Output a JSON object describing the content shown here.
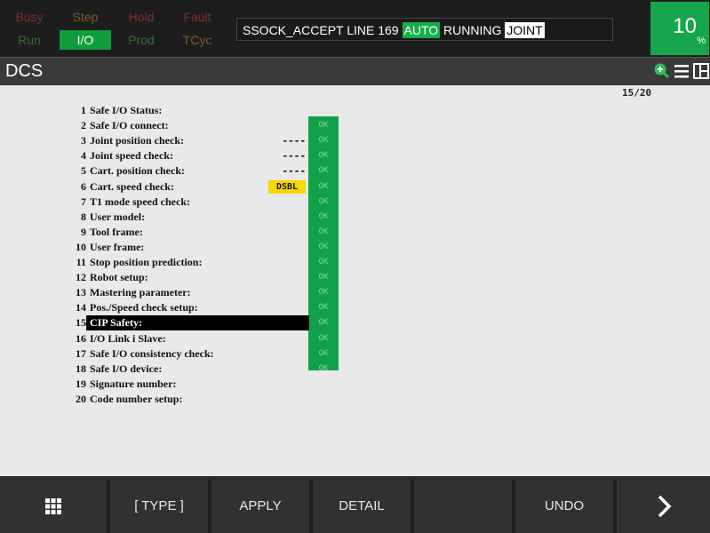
{
  "status": {
    "indicators": [
      {
        "id": "busy",
        "label": "Busy",
        "state": "off",
        "color": "#7a2e2e"
      },
      {
        "id": "step",
        "label": "Step",
        "state": "off",
        "color": "#7a5a2a"
      },
      {
        "id": "hold",
        "label": "Hold",
        "state": "off",
        "color": "#7a2e2e"
      },
      {
        "id": "fault",
        "label": "Fault",
        "state": "off",
        "color": "#7a2e2e"
      },
      {
        "id": "run",
        "label": "Run",
        "state": "off",
        "color": "#356a36"
      },
      {
        "id": "io",
        "label": "I/O",
        "state": "on",
        "color": "#0f9d3a"
      },
      {
        "id": "prod",
        "label": "Prod",
        "state": "off",
        "color": "#356a36"
      },
      {
        "id": "tcyc",
        "label": "TCyc",
        "state": "off",
        "color": "#7a5a2a"
      }
    ],
    "message": {
      "program": "SSOCK_ACCEPT LINE 169",
      "mode": "AUTO",
      "state": "RUNNING",
      "coord": "JOINT"
    },
    "override": {
      "value": "10",
      "unit": "%"
    }
  },
  "title": {
    "text": "DCS",
    "icons": [
      "zoom-in-icon",
      "menu-icon",
      "split-screen-icon"
    ]
  },
  "page_indicator": "15/20",
  "items": [
    {
      "num": "1",
      "label": "Safe I/O Status:",
      "value": "",
      "status": ""
    },
    {
      "num": "2",
      "label": "Safe I/O connect:",
      "value": "",
      "status": "OK"
    },
    {
      "num": "3",
      "label": "Joint position check:",
      "value": "----",
      "status": "OK"
    },
    {
      "num": "4",
      "label": "Joint speed check:",
      "value": "----",
      "status": "OK"
    },
    {
      "num": "5",
      "label": "Cart. position check:",
      "value": "----",
      "status": "OK"
    },
    {
      "num": "6",
      "label": "Cart. speed check:",
      "value": "DSBL",
      "status": "OK"
    },
    {
      "num": "7",
      "label": "T1 mode speed check:",
      "value": "",
      "status": "OK"
    },
    {
      "num": "8",
      "label": "User model:",
      "value": "",
      "status": "OK"
    },
    {
      "num": "9",
      "label": "Tool frame:",
      "value": "",
      "status": "OK"
    },
    {
      "num": "10",
      "label": "User frame:",
      "value": "",
      "status": "OK"
    },
    {
      "num": "11",
      "label": "Stop position prediction:",
      "value": "",
      "status": "OK"
    },
    {
      "num": "12",
      "label": "Robot setup:",
      "value": "",
      "status": "OK"
    },
    {
      "num": "13",
      "label": "Mastering parameter:",
      "value": "",
      "status": "OK"
    },
    {
      "num": "14",
      "label": "Pos./Speed check setup:",
      "value": "",
      "status": "OK"
    },
    {
      "num": "15",
      "label": "CIP Safety:",
      "value": "",
      "status": "OK",
      "selected": true
    },
    {
      "num": "16",
      "label": "I/O Link i Slave:",
      "value": "",
      "status": "OK"
    },
    {
      "num": "17",
      "label": "Safe I/O consistency check:",
      "value": "",
      "status": "OK"
    },
    {
      "num": "18",
      "label": "Safe I/O device:",
      "value": "",
      "status": "OK"
    },
    {
      "num": "19",
      "label": "Signature number:",
      "value": "",
      "status": ""
    },
    {
      "num": "20",
      "label": "Code number setup:",
      "value": "",
      "status": ""
    }
  ],
  "function_keys": [
    {
      "id": "menu",
      "label": "",
      "icon": "grid-icon"
    },
    {
      "id": "type",
      "label": "[ TYPE ]"
    },
    {
      "id": "apply",
      "label": "APPLY"
    },
    {
      "id": "detail",
      "label": "DETAIL"
    },
    {
      "id": "blank",
      "label": ""
    },
    {
      "id": "undo",
      "label": "UNDO"
    },
    {
      "id": "next",
      "label": "",
      "icon": "chevron-right-icon"
    }
  ],
  "colors": {
    "ok_green": "#11a14a",
    "dsbl_yellow": "#f7d700",
    "auto_green": "#13b04a",
    "override_green": "#16a74a"
  }
}
